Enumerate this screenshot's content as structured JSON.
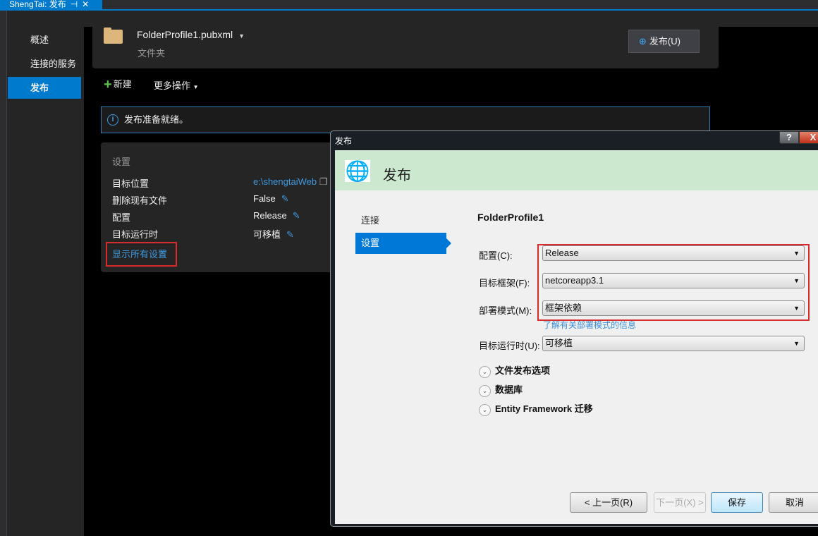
{
  "doc_tab": {
    "title": "ShengTai: 发布",
    "pin_icon": "pin-icon",
    "close_icon": "close-icon"
  },
  "sidebar": {
    "items": [
      {
        "label": "概述"
      },
      {
        "label": "连接的服务"
      },
      {
        "label": "发布",
        "active": true
      }
    ]
  },
  "profile": {
    "name": "FolderProfile1.pubxml",
    "type": "文件夹",
    "publish_button": "发布(U)"
  },
  "toolbar": {
    "new_label": "新建",
    "more_label": "更多操作"
  },
  "info": {
    "message": "发布准备就绪。"
  },
  "settings": {
    "heading": "设置",
    "rows": [
      {
        "label": "目标位置",
        "value": "e:\\shengtaiWeb"
      },
      {
        "label": "删除现有文件",
        "value": "False"
      },
      {
        "label": "配置",
        "value": "Release"
      },
      {
        "label": "目标运行时",
        "value": "可移植"
      }
    ],
    "show_all": "显示所有设置"
  },
  "dialog": {
    "title": "发布",
    "help": "?",
    "close": "X",
    "header": "发布",
    "nav": [
      {
        "label": "连接"
      },
      {
        "label": "设置",
        "active": true
      }
    ],
    "profile_name": "FolderProfile1",
    "fields": [
      {
        "label": "配置(C):",
        "value": "Release"
      },
      {
        "label": "目标框架(F):",
        "value": "netcoreapp3.1"
      },
      {
        "label": "部署模式(M):",
        "value": "框架依赖"
      },
      {
        "label": "目标运行时(U):",
        "value": "可移植"
      }
    ],
    "learn_link": "了解有关部署模式的信息",
    "sections": [
      "文件发布选项",
      "数据库",
      "Entity Framework 迁移"
    ],
    "buttons": {
      "prev": "< 上一页(R)",
      "next": "下一页(X) >",
      "save": "保存",
      "cancel": "取消"
    }
  },
  "colors": {
    "accent": "#007acc",
    "highlight": "#d92b2b",
    "header_green": "#cce8cf"
  }
}
